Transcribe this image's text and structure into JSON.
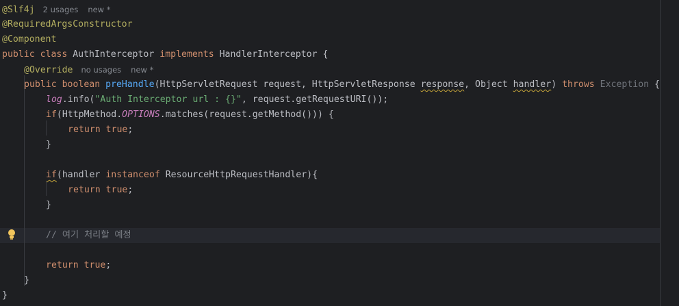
{
  "editor": {
    "lines": [
      {
        "indent": 0,
        "tokens": [
          {
            "text": "@Slf4j",
            "cls": "ann"
          },
          {
            "text": "2 usages",
            "cls": "hint"
          },
          {
            "text": "new *",
            "cls": "hint"
          }
        ]
      },
      {
        "indent": 0,
        "tokens": [
          {
            "text": "@RequiredArgsConstructor",
            "cls": "ann"
          }
        ]
      },
      {
        "indent": 0,
        "tokens": [
          {
            "text": "@Component",
            "cls": "ann"
          }
        ]
      },
      {
        "indent": 0,
        "tokens": [
          {
            "text": "public class ",
            "cls": "kw"
          },
          {
            "text": "AuthInterceptor ",
            "cls": "cls"
          },
          {
            "text": "implements ",
            "cls": "kw"
          },
          {
            "text": "HandlerInterceptor {",
            "cls": "cls"
          }
        ]
      },
      {
        "indent": 1,
        "tokens": [
          {
            "text": "@Override",
            "cls": "ann"
          },
          {
            "text": "no usages",
            "cls": "hint"
          },
          {
            "text": "new *",
            "cls": "hint"
          }
        ]
      },
      {
        "indent": 1,
        "tokens": [
          {
            "text": "public boolean ",
            "cls": "kw"
          },
          {
            "text": "preHandle",
            "cls": "fn"
          },
          {
            "text": "(HttpServletRequest request, HttpServletResponse ",
            "cls": "cls"
          },
          {
            "text": "response",
            "cls": "cls squiggle"
          },
          {
            "text": ", Object ",
            "cls": "cls"
          },
          {
            "text": "handler",
            "cls": "cls squiggle"
          },
          {
            "text": ") ",
            "cls": "cls"
          },
          {
            "text": "throws ",
            "cls": "kw"
          },
          {
            "text": "Exception",
            "cls": "dim"
          },
          {
            "text": " {",
            "cls": "cls"
          }
        ]
      },
      {
        "indent": 2,
        "tokens": [
          {
            "text": "log",
            "cls": "fld"
          },
          {
            "text": ".info(",
            "cls": "cls"
          },
          {
            "text": "\"Auth Interceptor url : {}\"",
            "cls": "str"
          },
          {
            "text": ", request.getRequestURI());",
            "cls": "cls"
          }
        ]
      },
      {
        "indent": 2,
        "tokens": [
          {
            "text": "if",
            "cls": "kw"
          },
          {
            "text": "(HttpMethod.",
            "cls": "cls"
          },
          {
            "text": "OPTIONS",
            "cls": "fld"
          },
          {
            "text": ".matches(request.getMethod())) {",
            "cls": "cls"
          }
        ]
      },
      {
        "indent": 3,
        "tokens": [
          {
            "text": "return true",
            "cls": "kw"
          },
          {
            "text": ";",
            "cls": "cls"
          }
        ]
      },
      {
        "indent": 2,
        "tokens": [
          {
            "text": "}",
            "cls": "cls"
          }
        ]
      },
      {
        "indent": 0,
        "tokens": []
      },
      {
        "indent": 2,
        "tokens": [
          {
            "text": "if",
            "cls": "kw squiggle"
          },
          {
            "text": "(handler ",
            "cls": "cls"
          },
          {
            "text": "instanceof ",
            "cls": "kw"
          },
          {
            "text": "ResourceHttpRequestHandler){",
            "cls": "cls"
          }
        ]
      },
      {
        "indent": 3,
        "tokens": [
          {
            "text": "return true",
            "cls": "kw"
          },
          {
            "text": ";",
            "cls": "cls"
          }
        ]
      },
      {
        "indent": 2,
        "tokens": [
          {
            "text": "}",
            "cls": "cls"
          }
        ]
      },
      {
        "indent": 0,
        "tokens": []
      },
      {
        "indent": 2,
        "current": true,
        "tokens": [
          {
            "text": "// 여기 처리할 예정",
            "cls": "cmt"
          }
        ]
      },
      {
        "indent": 0,
        "tokens": []
      },
      {
        "indent": 2,
        "tokens": [
          {
            "text": "return true",
            "cls": "kw"
          },
          {
            "text": ";",
            "cls": "cls"
          }
        ]
      },
      {
        "indent": 1,
        "tokens": [
          {
            "text": "}",
            "cls": "cls"
          }
        ]
      },
      {
        "indent": 0,
        "tokens": [
          {
            "text": "}",
            "cls": "cls"
          }
        ]
      }
    ]
  },
  "gutter": {
    "intention_icon": "lightbulb-icon"
  }
}
